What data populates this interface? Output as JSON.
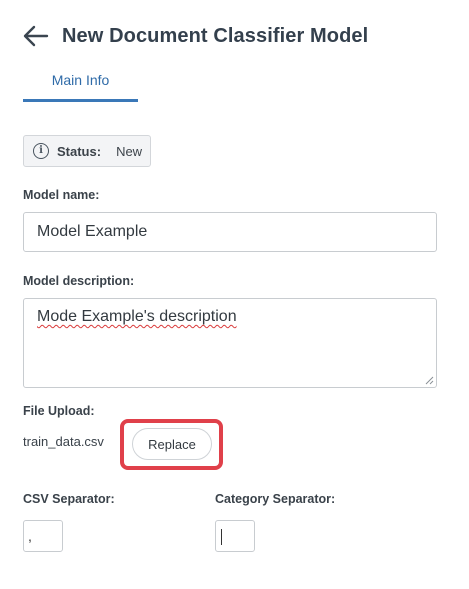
{
  "header": {
    "title": "New Document Classifier Model",
    "back_icon": "arrow-left-icon"
  },
  "tabs": [
    {
      "label": "Main Info",
      "active": true
    }
  ],
  "status": {
    "label": "Status:",
    "value": "New",
    "icon": "info-icon"
  },
  "form": {
    "model_name": {
      "label": "Model name:",
      "value": "Model Example"
    },
    "model_description": {
      "label": "Model description:",
      "value": "Mode Example's description"
    },
    "file_upload": {
      "label": "File Upload:",
      "file_name": "train_data.csv",
      "replace_label": "Replace"
    },
    "csv_separator": {
      "label": "CSV Separator:",
      "value": ","
    },
    "category_separator": {
      "label": "Category Separator:",
      "value": ""
    }
  },
  "colors": {
    "accent": "#3a78b8",
    "highlight": "#e0404a"
  }
}
